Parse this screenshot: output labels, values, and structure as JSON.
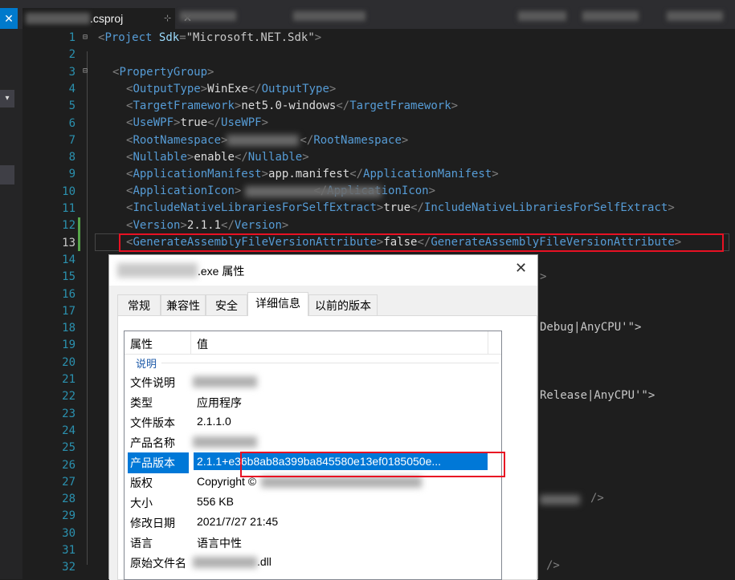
{
  "editor": {
    "tab": {
      "name": ".csproj",
      "pin": "⊹",
      "close": "✕"
    },
    "left": {
      "close": "✕",
      "dropdown": "▾"
    },
    "lines": [
      "1",
      "2",
      "3",
      "4",
      "5",
      "6",
      "7",
      "8",
      "9",
      "10",
      "11",
      "12",
      "13",
      "14",
      "15",
      "16",
      "17",
      "18",
      "19",
      "20",
      "21",
      "22",
      "23",
      "24",
      "25",
      "26",
      "27",
      "28",
      "29",
      "30",
      "31",
      "32"
    ],
    "code": {
      "l1": {
        "open": "<",
        "tag": "Project",
        "sp": " ",
        "attr": "Sdk",
        "eq": "=",
        "val": "\"Microsoft.NET.Sdk\"",
        "close": ">"
      },
      "l3": {
        "open": "<",
        "tag": "PropertyGroup",
        "close": ">"
      },
      "props": [
        {
          "name": "OutputType",
          "value": "WinExe"
        },
        {
          "name": "TargetFramework",
          "value": "net5.0-windows"
        },
        {
          "name": "UseWPF",
          "value": "true"
        },
        {
          "name": "RootNamespace",
          "value": ""
        },
        {
          "name": "Nullable",
          "value": "enable"
        },
        {
          "name": "ApplicationManifest",
          "value": "app.manifest"
        },
        {
          "name": "ApplicationIcon",
          "value": ""
        },
        {
          "name": "IncludeNativeLibrariesForSelfExtract",
          "value": "true"
        },
        {
          "name": "Version",
          "value": "2.1.1"
        },
        {
          "name": "GenerateAssemblyFileVersionAttribute",
          "value": "false"
        }
      ],
      "frag15": ">",
      "frag18": "Debug|AnyCPU'\">",
      "frag22": "Release|AnyCPU'\">",
      "frag28": "/>",
      "frag32": "/>"
    }
  },
  "dialog": {
    "title_suffix": ".exe 属性",
    "close": "✕",
    "tabs": [
      "常规",
      "兼容性",
      "安全",
      "详细信息",
      "以前的版本"
    ],
    "active_tab": "详细信息",
    "columns": {
      "property": "属性",
      "value": "值"
    },
    "group": "说明",
    "rows": [
      {
        "key": "文件说明",
        "value": ""
      },
      {
        "key": "类型",
        "value": "应用程序"
      },
      {
        "key": "文件版本",
        "value": "2.1.1.0"
      },
      {
        "key": "产品名称",
        "value": ""
      },
      {
        "key": "产品版本",
        "value": "2.1.1+e36b8ab8a399ba845580e13ef0185050e..."
      },
      {
        "key": "版权",
        "value": "Copyright ©"
      },
      {
        "key": "大小",
        "value": "556 KB"
      },
      {
        "key": "修改日期",
        "value": "2021/7/27 21:45"
      },
      {
        "key": "语言",
        "value": "语言中性"
      },
      {
        "key": "原始文件名",
        "value": ".dll"
      }
    ]
  },
  "colors": {
    "highlight_box": "#e81123",
    "selection": "#0078d7",
    "tag": "#569cd6",
    "line_number": "#2b91af"
  }
}
